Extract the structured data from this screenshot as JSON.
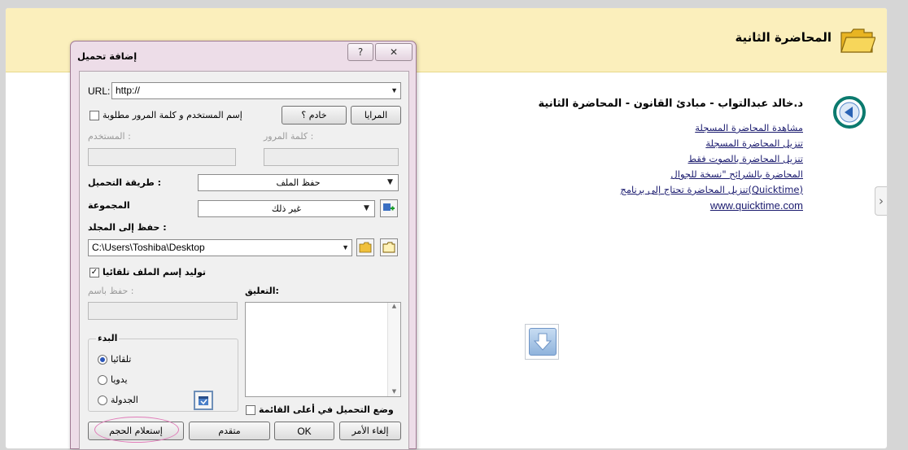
{
  "page": {
    "header_title": "المحاضرة الثانية",
    "lecture_title": "د.خالد عبدالتواب - مبادئ القانون - المحاضرة الثانية",
    "links": [
      "مشاهدة المحاضرة المسجلة",
      "تنزيل المحاضرة المسجلة",
      "تنزيل المحاضرة بالصوت فقط",
      "المحاضرة بالشرائح \"نسخة للجوال",
      "(Quicktime)تنزيل المحاضرة تحتاج إلى برنامج",
      "www.quicktime.com"
    ],
    "next_arrow": "›"
  },
  "dialog": {
    "title": "إضافة تحميل",
    "help_label": "?",
    "close_label": "✕",
    "url_label": "URL:",
    "url_value": "http://",
    "login_checkbox_label": "إسم المستخدم و كلمة المرور مطلوبة",
    "mirrors_button": "المرايا",
    "proxy_button": "خادم ؟",
    "username_label": ": المستخدم",
    "password_label": ": كلمة المرور",
    "method_label": ": طريقة التحميل",
    "method_value": "حفظ الملف",
    "group_label": "المجموعة",
    "group_value": "غير ذلك",
    "save_to_label": ": حفظ إلى المجلد",
    "save_to_value": "C:\\Users\\Toshiba\\Desktop",
    "auto_name_label": "توليد إسم الملف تلقائيا",
    "auto_name_checked": "✓",
    "save_as_label": ": حفظ باسم",
    "comment_label": ":التعليق",
    "start_group_label": "البدء",
    "start_options": [
      "تلقائيا",
      "يدويا",
      "الجدولة"
    ],
    "top_queue_label": "وضع التحميل في أعلى القائمة",
    "buttons": {
      "size": "إستعلام الحجم",
      "advanced": "متقدم",
      "ok": "OK",
      "cancel": "إلغاء الأمر"
    }
  }
}
